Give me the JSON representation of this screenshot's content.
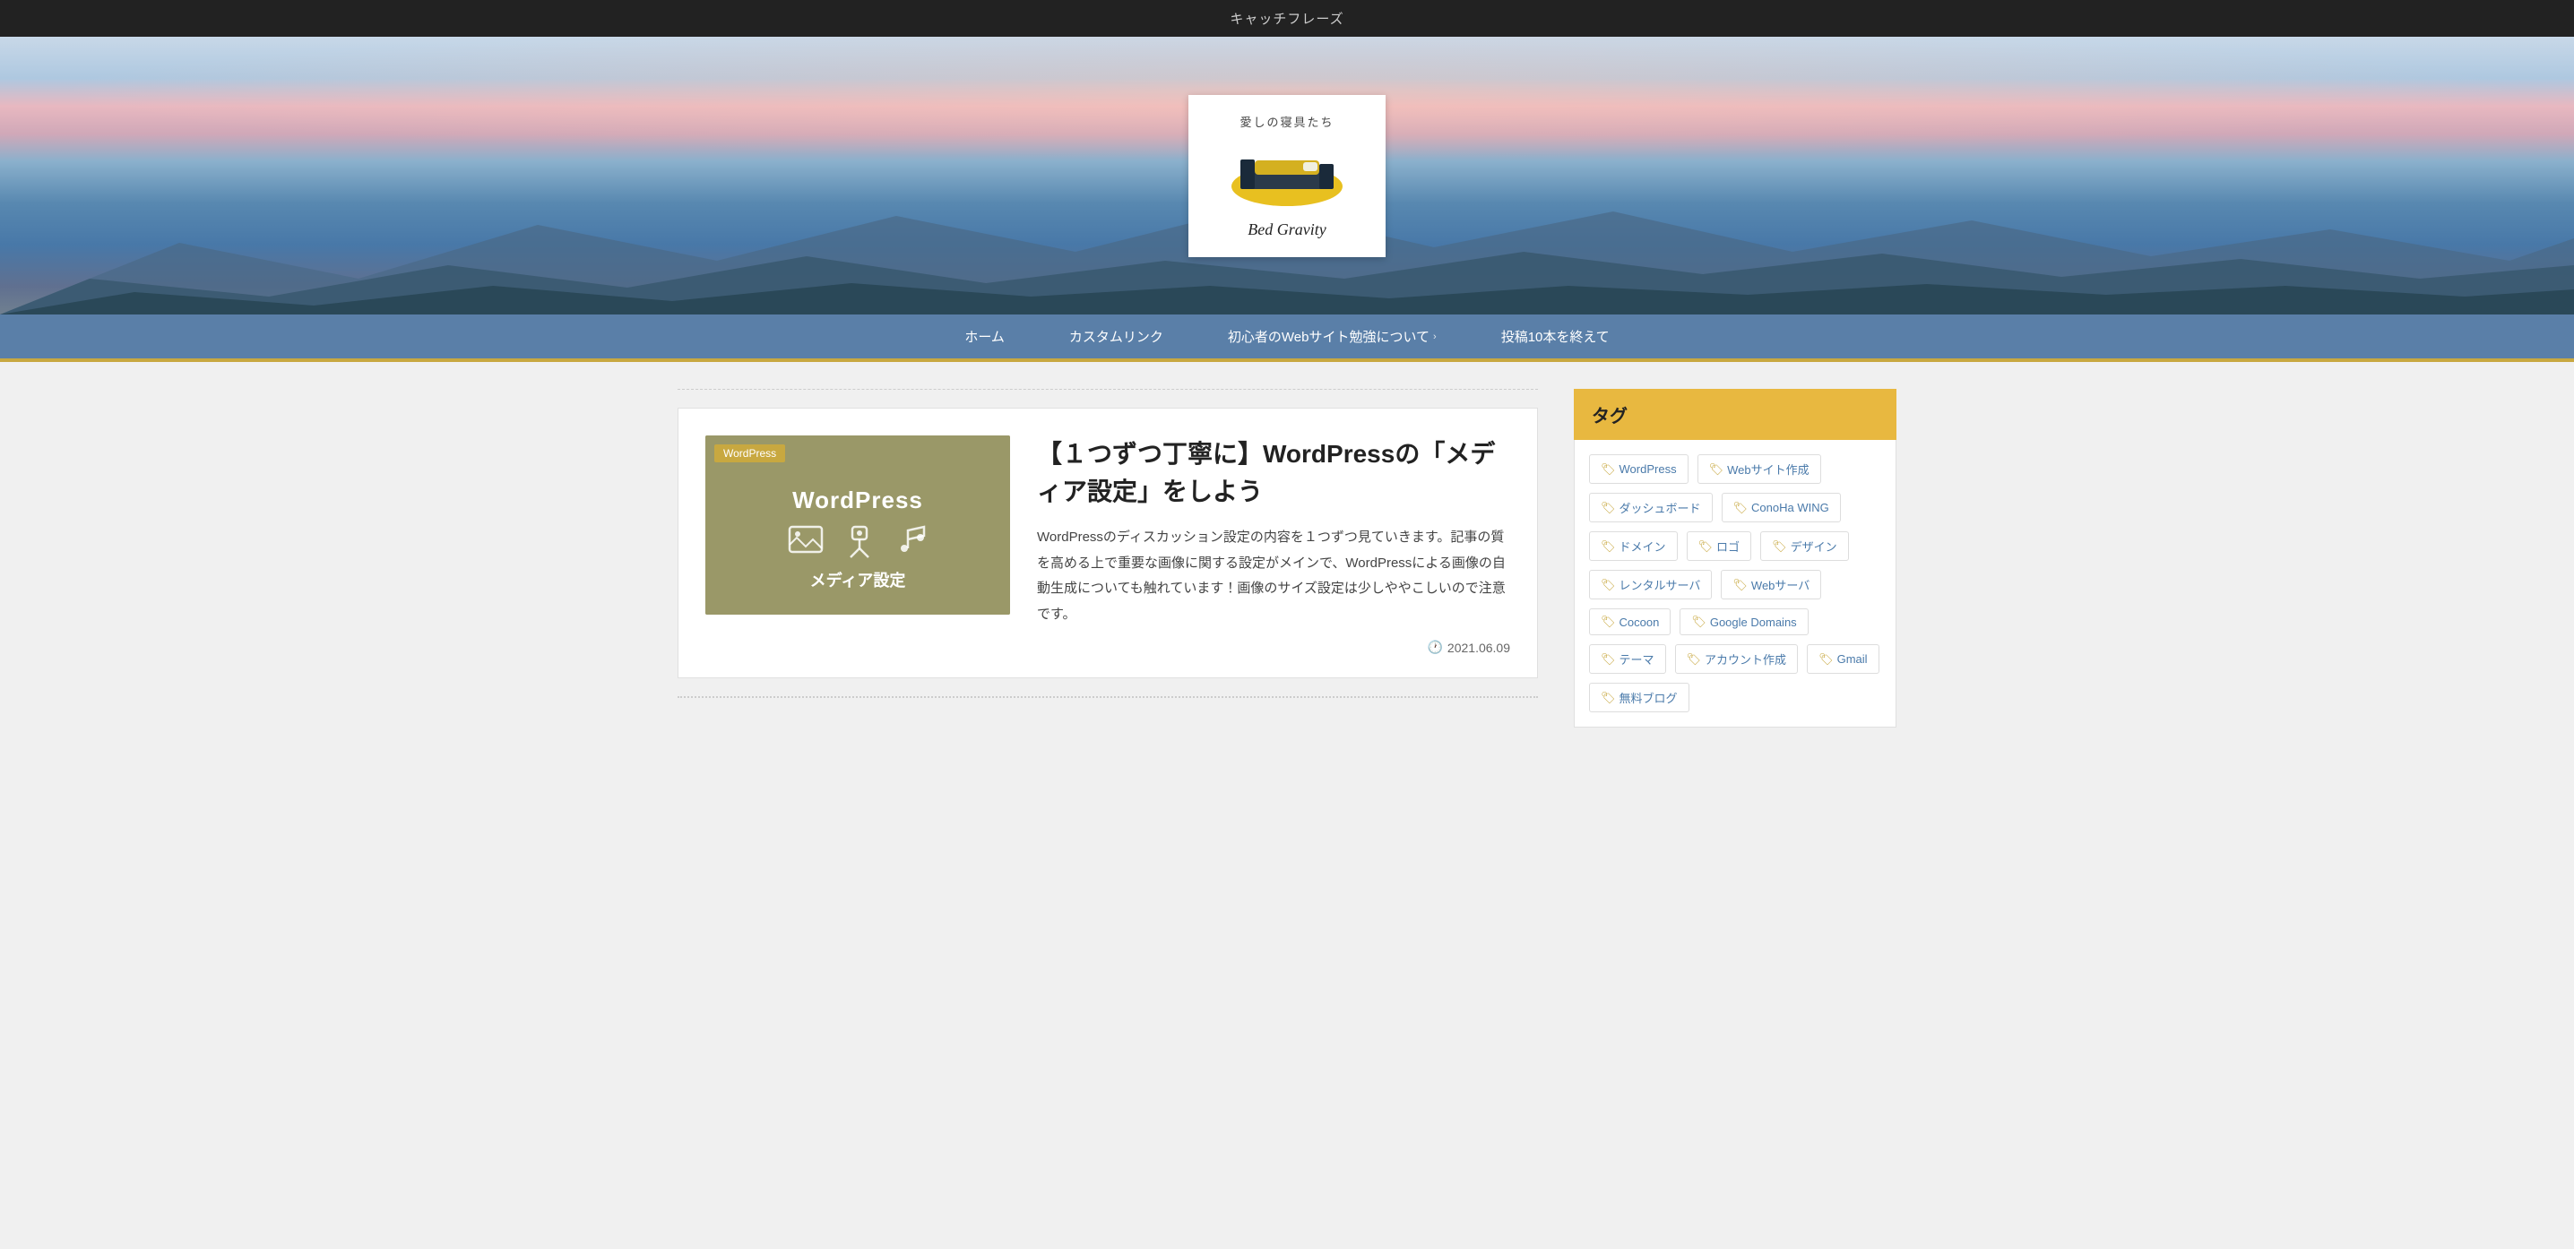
{
  "topbar": {
    "catchphrase": "キャッチフレーズ"
  },
  "header": {
    "site_subtitle": "愛しの寝具たち",
    "site_script_name": "Bed Gravity"
  },
  "nav": {
    "items": [
      {
        "label": "ホーム",
        "has_dropdown": false
      },
      {
        "label": "カスタムリンク",
        "has_dropdown": false
      },
      {
        "label": "初心者のWebサイト勉強について",
        "has_dropdown": true
      },
      {
        "label": "投稿10本を終えて",
        "has_dropdown": false
      }
    ]
  },
  "article": {
    "category_badge": "WordPress",
    "thumbnail_wp_label": "WordPress",
    "thumbnail_subtitle": "メディア設定",
    "title": "【１つずつ丁寧に】WordPressの「メディア設定」をしよう",
    "excerpt": "WordPressのディスカッション設定の内容を１つずつ見ていきます。記事の質を高める上で重要な画像に関する設定がメインで、WordPressによる画像の自動生成についても触れています！画像のサイズ設定は少しややこしいので注意です。",
    "date": "2021.06.09"
  },
  "sidebar": {
    "tags_widget_title": "タグ",
    "tags": [
      {
        "label": "WordPress"
      },
      {
        "label": "Webサイト作成"
      },
      {
        "label": "ダッシュボード"
      },
      {
        "label": "ConoHa WING"
      },
      {
        "label": "ドメイン"
      },
      {
        "label": "ロゴ"
      },
      {
        "label": "デザイン"
      },
      {
        "label": "レンタルサーバ"
      },
      {
        "label": "Webサーバ"
      },
      {
        "label": "Cocoon"
      },
      {
        "label": "Google Domains"
      },
      {
        "label": "テーマ"
      },
      {
        "label": "アカウント作成"
      },
      {
        "label": "Gmail"
      },
      {
        "label": "無料ブログ"
      }
    ]
  },
  "icons": {
    "tag": "🏷",
    "calendar": "🕐",
    "chevron_down": "›"
  }
}
